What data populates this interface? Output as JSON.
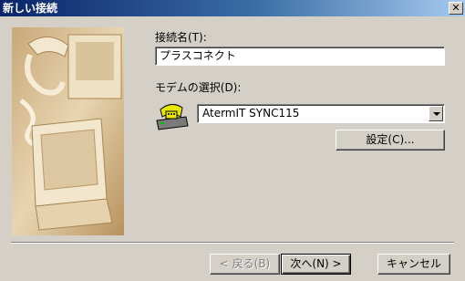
{
  "window": {
    "title": "新しい接続",
    "close_glyph": "✕"
  },
  "form": {
    "connection_name_label": "接続名(T):",
    "connection_name_value": "プラスコネクト",
    "modem_label": "モデムの選択(D):",
    "modem_selected": "AtermIT SYNC115",
    "settings_button": "設定(C)..."
  },
  "footer": {
    "back_button": "< 戻る(B)",
    "next_button": "次へ(N) >",
    "cancel_button": "キャンセル"
  },
  "icons": {
    "wizard_image": "phone-monitor-illustration",
    "modem": "modem-telephone-icon"
  }
}
